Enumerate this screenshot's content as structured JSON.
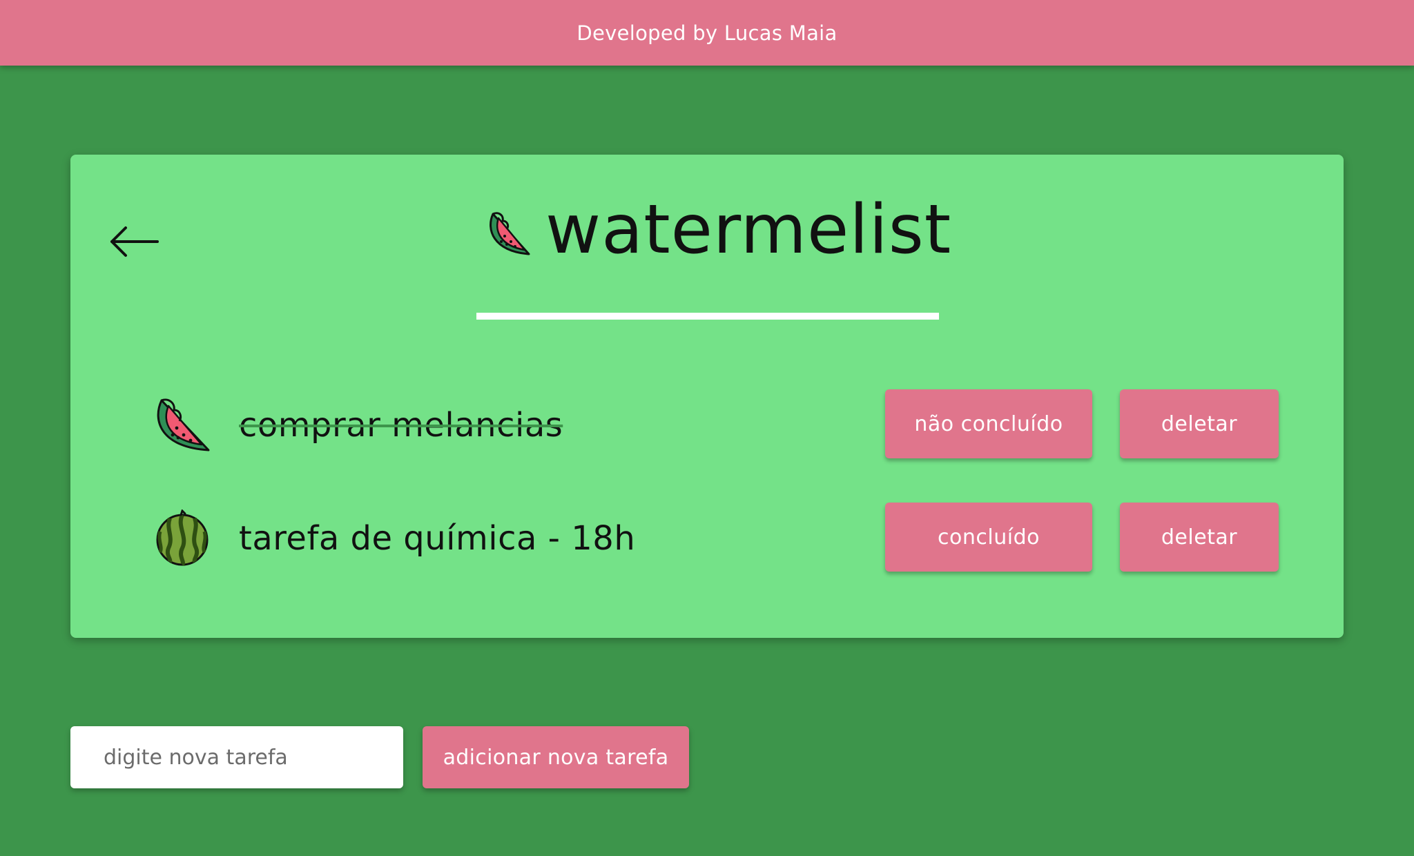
{
  "header": {
    "credit": "Developed by Lucas Maia"
  },
  "app": {
    "title": "watermelist",
    "back_icon": "back-arrow-icon",
    "title_icon": "watermelon-slice-icon"
  },
  "tasks": [
    {
      "text": "comprar melancias",
      "completed": true,
      "icon": "watermelon-slice-icon",
      "toggle_label": "não concluído",
      "delete_label": "deletar"
    },
    {
      "text": "tarefa de química - 18h",
      "completed": false,
      "icon": "whole-watermelon-icon",
      "toggle_label": "concluído",
      "delete_label": "deletar"
    }
  ],
  "new_task": {
    "placeholder": "digite nova tarefa",
    "value": "",
    "add_label": "adicionar nova tarefa"
  },
  "colors": {
    "background": "#3d954b",
    "card": "#74e288",
    "accent": "#e0758c",
    "title_underline": "#ffffff"
  }
}
